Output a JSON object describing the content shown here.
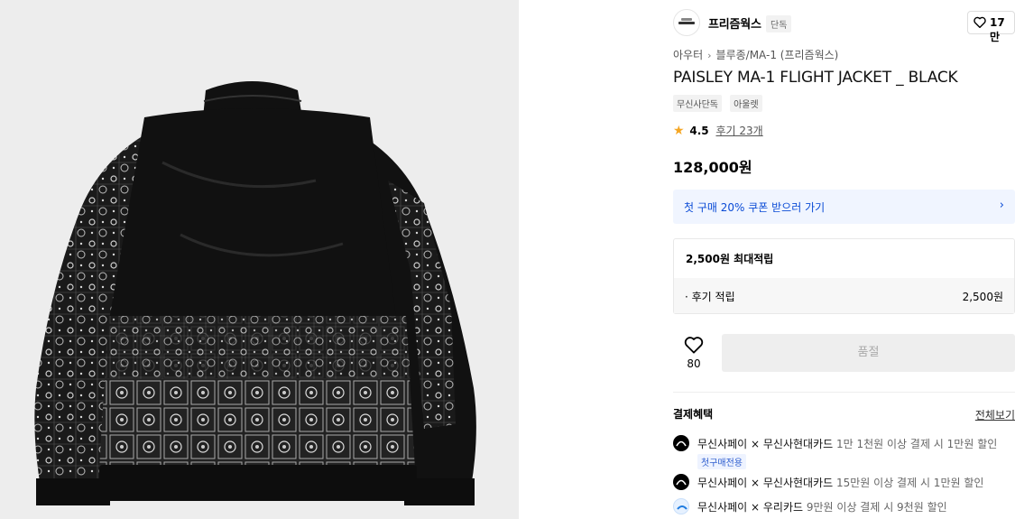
{
  "brand": {
    "name": "프리즘웍스",
    "tag": "단독",
    "likes": "17만"
  },
  "breadcrumb": {
    "category": "아우터",
    "subcategory": "블루종/MA-1 (프리즘웍스)"
  },
  "product": {
    "title": "PAISLEY MA-1 FLIGHT JACKET _ BLACK",
    "badges": [
      "무신사단독",
      "아울렛"
    ],
    "rating": "4.5",
    "reviews": "후기 23개",
    "price": "128,000원"
  },
  "coupon": {
    "text": "첫 구매 20% 쿠폰 받으러 가기"
  },
  "points": {
    "header": "2,500원 최대적립",
    "row_label": "· 후기 적립",
    "row_value": "2,500원"
  },
  "actions": {
    "wish_count": "80",
    "soldout_label": "품절"
  },
  "payment": {
    "header": "결제혜택",
    "view_all": "전체보기",
    "benefits": [
      {
        "main": "무신사페이 × 무신사현대카드",
        "detail": "1만 1천원 이상 결제 시 1만원 할인",
        "tag": "첫구매전용"
      },
      {
        "main": "무신사페이 × 무신사현대카드",
        "detail": "15만원 이상 결제 시 1만원 할인"
      },
      {
        "main": "무신사페이 × 우리카드",
        "detail": "9만원 이상 결제 시 9천원 할인"
      }
    ]
  },
  "colors": {
    "accent_blue": "#0a4bd6",
    "star": "#f5a623",
    "coupon_bg": "#f0f5ff"
  }
}
